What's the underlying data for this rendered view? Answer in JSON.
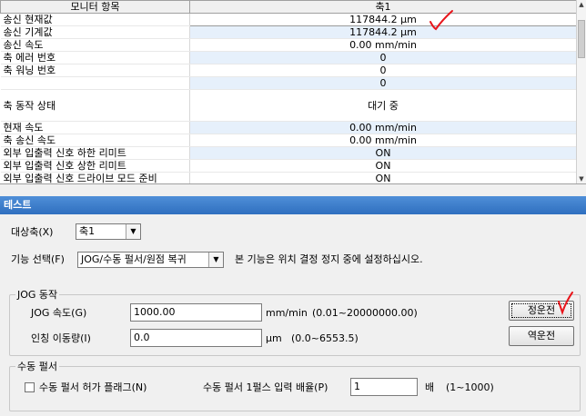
{
  "monitor": {
    "header": {
      "item": "모니터 항목",
      "axis": "축1"
    },
    "rows": [
      {
        "label": "송신 현재값",
        "value": "117844.2 μm"
      },
      {
        "label": "송신 기계값",
        "value": "117844.2 μm"
      },
      {
        "label": "송신 속도",
        "value": "0.00 mm/min"
      },
      {
        "label": "축 에러 번호",
        "value": "0"
      },
      {
        "label": "축 워닝 번호",
        "value": "0"
      },
      {
        "label": "",
        "value": "0"
      },
      {
        "label": "축 동작 상태",
        "value": "대기 중"
      },
      {
        "label": "현재 속도",
        "value": "0.00 mm/min"
      },
      {
        "label": "축 송신 속도",
        "value": "0.00 mm/min"
      },
      {
        "label": "외부 입출력 신호 하한 리미트",
        "value": "ON"
      },
      {
        "label": "외부 입출력 신호 상한 리미트",
        "value": "ON"
      },
      {
        "label": "외부 입출력 신호 드라이브 모드 준비",
        "value": "ON"
      }
    ]
  },
  "test": {
    "title": "테스트",
    "target_axis_label": "대상축(X)",
    "target_axis_value": "축1",
    "function_label": "기능 선택(F)",
    "function_value": "JOG/수동 펄서/원점 복귀",
    "function_note": "본 기능은 위치 결정 정지 중에 설정하십시오.",
    "jog": {
      "legend": "JOG 동작",
      "speed_label": "JOG 속도(G)",
      "speed_value": "1000.00",
      "speed_unit": "mm/min",
      "speed_range": "(0.01~20000000.00)",
      "inching_label": "인칭 이동량(I)",
      "inching_value": "0.0",
      "inching_unit": "μm",
      "inching_range": "(0.0~6553.5)",
      "forward_button": "정운전",
      "reverse_button": "역운전"
    },
    "pulser": {
      "legend": "수동 펄서",
      "enable_label": "수동 펄서 허가 플래그(N)",
      "enable_checked": false,
      "ratio_label": "수동 펄서 1펄스 입력 배율(P)",
      "ratio_value": "1",
      "ratio_unit": "배",
      "ratio_range": "(1~1000)"
    }
  },
  "colors": {
    "annotation": "#e8151b",
    "title_bar": "#2f6fbf"
  }
}
